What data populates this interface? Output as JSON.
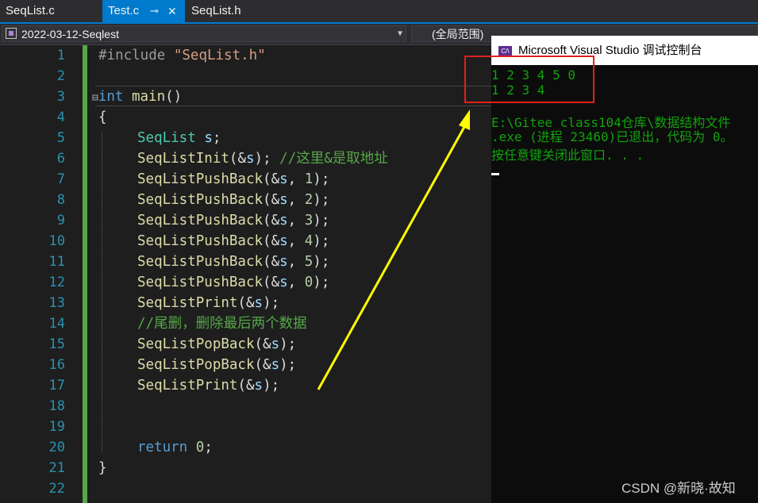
{
  "tabs": [
    {
      "label": "SeqList.c"
    },
    {
      "label": "Test.c",
      "pin_icon": "pin-icon",
      "close_icon": "close-icon",
      "active": true
    },
    {
      "label": "SeqList.h"
    }
  ],
  "navbar": {
    "project": "2022-03-12-Seqlest",
    "scope": "(全局范围)"
  },
  "editor": {
    "line_numbers": [
      "1",
      "2",
      "3",
      "4",
      "5",
      "6",
      "7",
      "8",
      "9",
      "10",
      "11",
      "12",
      "13",
      "14",
      "15",
      "16",
      "17",
      "18",
      "19",
      "20",
      "21",
      "22"
    ],
    "code": {
      "l1_directive": "#include",
      "l1_header": "\"SeqList.h\"",
      "l3_kw": "int",
      "l3_fn": "main",
      "l3_paren": "()",
      "l4": "{",
      "l5_type": "SeqList",
      "l5_var": "s",
      "l5_semi": ";",
      "l6_fn": "SeqListInit",
      "l6_open": "(&",
      "l6_var": "s",
      "l6_close": ");",
      "l6_comment": "//这里&是取地址",
      "push_fn": "SeqListPushBack",
      "push_open": "(&",
      "push_var": "s",
      "push_sep": ", ",
      "push_values": [
        "1",
        "2",
        "3",
        "4",
        "5",
        "0"
      ],
      "push_close": ");",
      "print_fn": "SeqListPrint",
      "print_open": "(&",
      "print_var": "s",
      "print_close": ");",
      "l14_comment": "//尾删，删除最后两个数据",
      "pop_fn": "SeqListPopBack",
      "pop_open": "(&",
      "pop_var": "s",
      "pop_close": ");",
      "l20_kw": "return",
      "l20_val": "0",
      "l20_semi": ";",
      "l21": "}"
    }
  },
  "console": {
    "title": "Microsoft Visual Studio 调试控制台",
    "icon_text": "C/\\",
    "output": [
      "1 2 3 4 5 0",
      "1 2 3 4",
      "",
      "E:\\Gitee class104仓库\\数据结构文件",
      ".exe (进程 23460)已退出，代码为 0。",
      "按任意键关闭此窗口. . ."
    ],
    "watermark": "CSDN @新晓·故知"
  },
  "colors": {
    "tab_active": "#007acc",
    "console_text": "#13a10e",
    "annotation_box": "#e02020",
    "annotation_arrow": "#ffff00"
  }
}
